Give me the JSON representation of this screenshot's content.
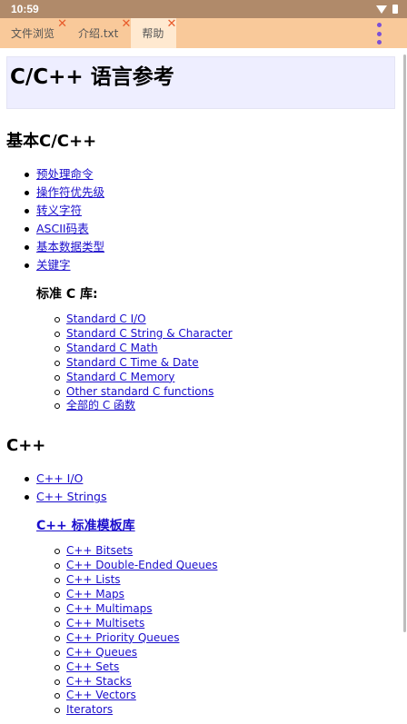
{
  "status_bar": {
    "time": "10:59"
  },
  "tabs": [
    {
      "label": "文件浏览",
      "close": "✕",
      "active": false
    },
    {
      "label": "介绍.txt",
      "close": "✕",
      "active": false
    },
    {
      "label": "帮助",
      "close": "✕",
      "active": true
    }
  ],
  "page": {
    "title": "C/C++ 语言参考",
    "section_basic": {
      "heading": "基本C/C++",
      "links": [
        "预处理命令",
        "操作符优先级",
        "转义字符",
        "ASCII码表",
        "基本数据类型",
        "关键字"
      ],
      "subheading": "标准 C 库:",
      "sublinks": [
        "Standard C I/O",
        "Standard C String & Character",
        "Standard C Math",
        "Standard C Time & Date",
        "Standard C Memory",
        "Other standard C functions",
        "全部的 C 函数"
      ]
    },
    "section_cpp": {
      "heading": "C++",
      "links": [
        "C++ I/O",
        "C++ Strings"
      ],
      "stl_heading": "C++ 标准模板库",
      "stl_links": [
        "C++ Bitsets",
        "C++ Double-Ended Queues",
        "C++ Lists",
        "C++ Maps",
        "C++ Multimaps",
        "C++ Multisets",
        "C++ Priority Queues",
        "C++ Queues",
        "C++ Sets",
        "C++ Stacks",
        "C++ Vectors",
        "Iterators"
      ]
    }
  }
}
